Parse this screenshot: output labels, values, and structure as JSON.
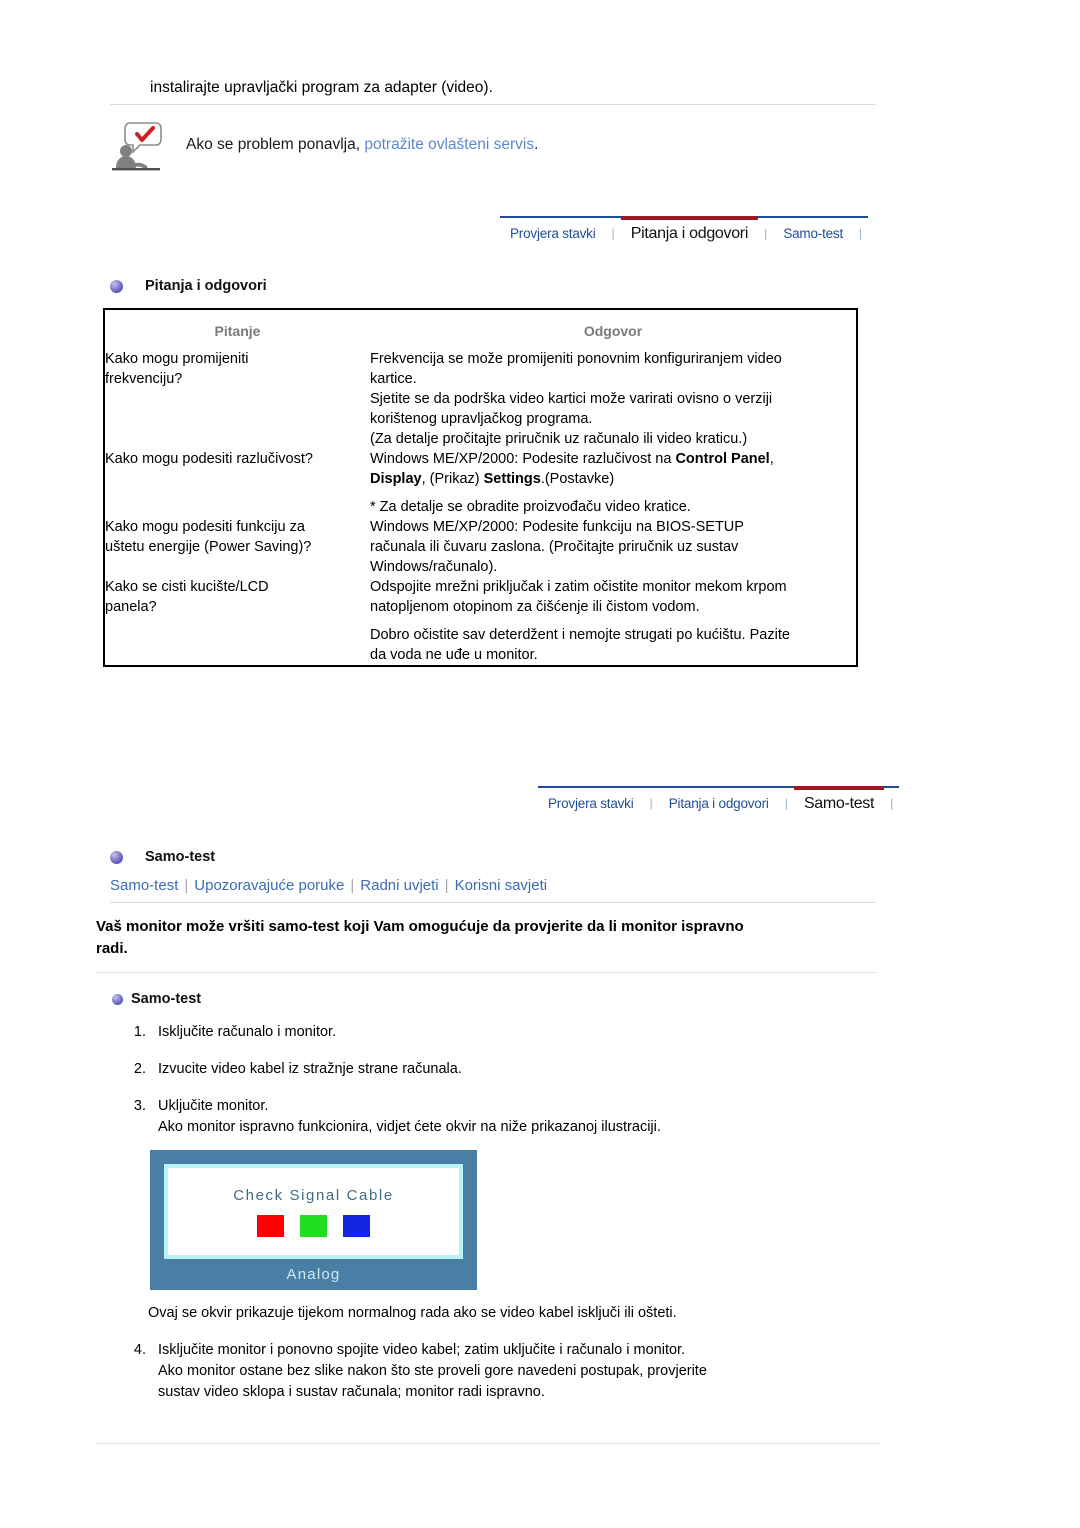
{
  "top": {
    "continuation_text": "instalirajte upravljački program za adapter (video)."
  },
  "note": {
    "icon": "person-speech-bubble-check-icon",
    "text_before_link": "Ako se problem ponavlja, ",
    "link_text": "potražite ovlašteni servis",
    "text_after_link": ".",
    "link_color": "#5b87d0"
  },
  "tabbar_faq": {
    "tabs": [
      {
        "label": "Provjera stavki",
        "active": false
      },
      {
        "label": "Pitanja i odgovori",
        "active": true
      },
      {
        "label": "Samo-test",
        "active": false
      }
    ],
    "separator": "❘",
    "active_border_color": "#9c1721",
    "inactive_color": "#1f4e96"
  },
  "tabbar_selftest": {
    "tabs": [
      {
        "label": "Provjera stavki",
        "active": false
      },
      {
        "label": "Pitanja i odgovori",
        "active": false
      },
      {
        "label": "Samo-test",
        "active": true
      }
    ],
    "separator": "❘",
    "active_border_color": "#9c1721",
    "inactive_color": "#1f4e96"
  },
  "faq": {
    "heading": "Pitanja i odgovori",
    "bullet": "purple-sphere-bullet-icon",
    "columns": {
      "question": "Pitanje",
      "answer": "Odgovor"
    },
    "rows": [
      {
        "question_l1": "Kako mogu promijeniti",
        "question_l2": "frekvenciju?",
        "answer_l1": "Frekvencija se može promijeniti ponovnim konfiguriranjem video",
        "answer_l2": "kartice."
      },
      {
        "question_l1": "",
        "question_l2": "",
        "answer_l1": "Sjetite se da podrška video kartici može varirati ovisno o verziji",
        "answer_l2": "korištenog upravljačkog programa.",
        "answer_l3": "(Za detalje pročitajte priručnik uz računalo ili video kraticu.)"
      },
      {
        "question_l1": "Kako mogu podesiti razlučivost?",
        "answer_pre": "Windows ME/XP/2000: Podesite razlučivost na ",
        "answer_b1": "Control Panel",
        "answer_mid1": ",",
        "answer_b2": "Display",
        "answer_mid2": ", (Prikaz) ",
        "answer_b3": "Settings",
        "answer_post": ".(Postavke)",
        "answer_note": "* Za detalje se obradite proizvođaču video kratice."
      },
      {
        "question_l1": "Kako mogu podesiti funkciju za",
        "question_l2": "uštetu energije (Power Saving)?",
        "answer_l1": "Windows ME/XP/2000: Podesite funkciju na BIOS-SETUP",
        "answer_l2": "računala ili čuvaru zaslona. (Pročitajte priručnik uz sustav",
        "answer_l3": "Windows/računalo)."
      },
      {
        "question_l1": "Kako se cisti kucište/LCD",
        "question_l2": "panela?",
        "answer_l1": "Odspojite mrežni priključak i zatim očistite monitor mekom krpom",
        "answer_l2": "natopljenom otopinom za čišćenje ili čistom vodom.",
        "answer_l3": "Dobro očistite sav deterdžent i nemojte strugati po kućištu. Pazite",
        "answer_l4": "da voda ne uđe u monitor."
      }
    ]
  },
  "selftest": {
    "heading": "Samo-test",
    "bullet": "purple-sphere-bullet-icon",
    "sublinks": [
      "Samo-test",
      "Upozoravajuće poruke",
      "Radni uvjeti",
      "Korisni savjeti"
    ],
    "sublink_separator": "|",
    "intro_l1": "Vaš monitor može vršiti samo-test koji Vam omogućuje da provjerite da li monitor ispravno",
    "intro_l2": "radi.",
    "bullet_heading": "Samo-test",
    "steps": [
      {
        "num": "1.",
        "lines": [
          "Isključite računalo i monitor."
        ]
      },
      {
        "num": "2.",
        "lines": [
          "Izvucite video kabel iz stražnje strane računala."
        ]
      },
      {
        "num": "3.",
        "lines": [
          "Uključite monitor.",
          "Ako monitor ispravno funkcionira, vidjet ćete okvir na niže prikazanoj ilustraciji."
        ]
      }
    ],
    "monitor_graphic": {
      "message": "Check Signal Cable",
      "label": "Analog",
      "swatch_colors": [
        "#ff0000",
        "#22dd22",
        "#1526e0"
      ],
      "bezel_color": "#4a7fa5",
      "inner_glow_color": "#b8f3f7"
    },
    "caption": "Ovaj se okvir prikazuje tijekom normalnog rada ako se video kabel isključi ili ošteti.",
    "steps2": [
      {
        "num": "4.",
        "lines": [
          "Isključite monitor i ponovno spojite video kabel; zatim uključite i računalo i monitor.",
          "Ako monitor ostane bez slike nakon što ste proveli gore navedeni postupak, provjerite",
          "sustav video sklopa i sustav računala; monitor radi ispravno."
        ]
      }
    ]
  }
}
